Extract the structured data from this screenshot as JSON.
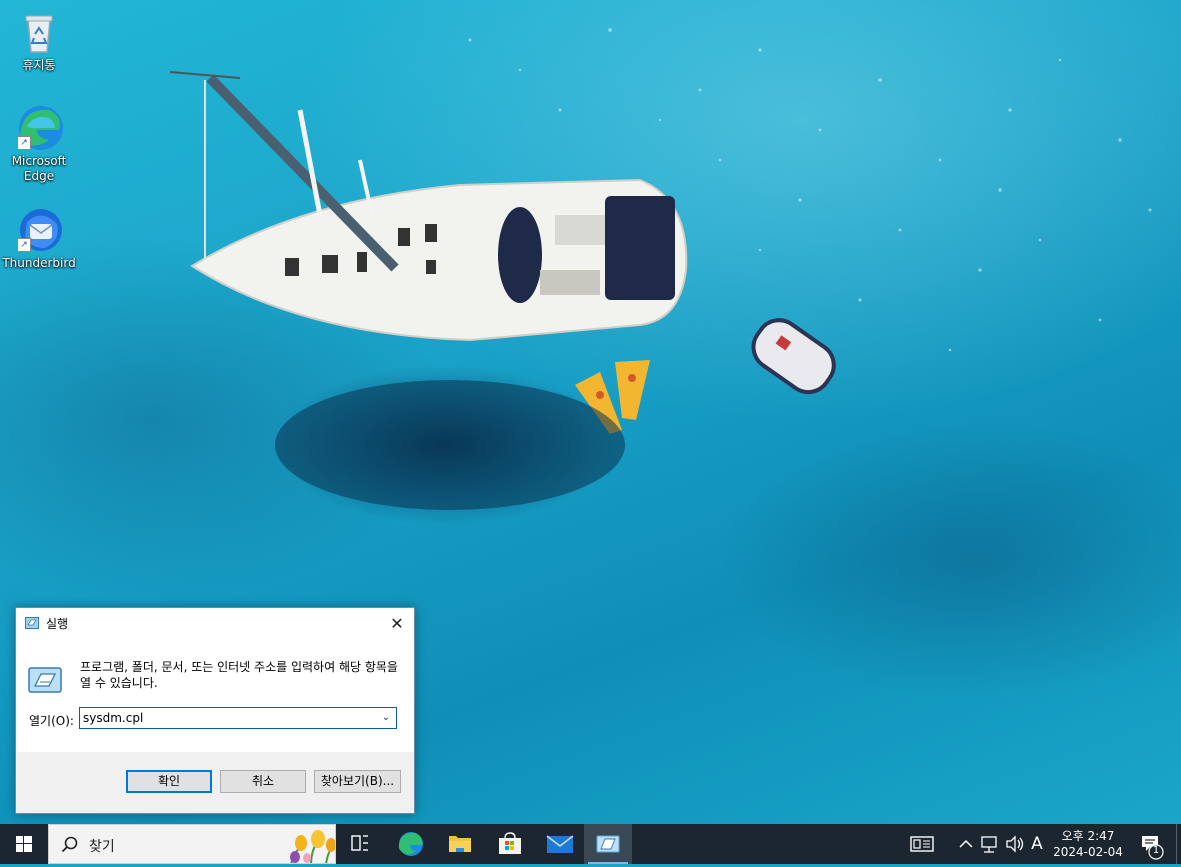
{
  "desktop": {
    "icons": [
      {
        "label": "휴지통",
        "icon": "recycle-bin-icon"
      },
      {
        "label": "Microsoft\nEdge",
        "icon": "edge-icon"
      },
      {
        "label": "Thunderbird",
        "icon": "thunderbird-icon"
      }
    ]
  },
  "run_dialog": {
    "title": "실행",
    "close_glyph": "✕",
    "description": "프로그램, 폴더, 문서, 또는 인터넷 주소를 입력하여 해당 항목을 열 수 있습니다.",
    "open_label": "열기(O):",
    "input_value": "sysdm.cpl",
    "ok_label": "확인",
    "cancel_label": "취소",
    "browse_label": "찾아보기(B)..."
  },
  "taskbar": {
    "search_placeholder": "찾기",
    "apps": [
      "task-view",
      "edge",
      "file-explorer",
      "microsoft-store",
      "mail",
      "run"
    ],
    "active_app": "run",
    "tray": {
      "input_indicator": "A",
      "time": "오후 2:47",
      "date": "2024-02-04",
      "notification_count": "1"
    }
  },
  "colors": {
    "accent": "#0078d7",
    "taskbar": "#1b2630",
    "wallpaper_water": "#1aa2c8"
  }
}
